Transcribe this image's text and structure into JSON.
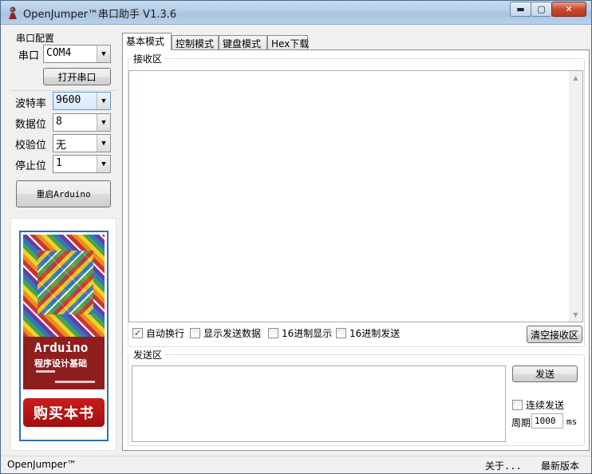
{
  "window": {
    "title": "OpenJumper™串口助手  V1.3.6",
    "controls": {
      "minimize": "▬",
      "maximize": "▢",
      "close": "✕"
    }
  },
  "left": {
    "group_title": "串口配置",
    "port_label": "串口",
    "port_value": "COM4",
    "open_button": "打开串口",
    "baud_label": "波特率",
    "baud_value": "9600",
    "databits_label": "数据位",
    "databits_value": "8",
    "parity_label": "校验位",
    "parity_value": "无",
    "stopbits_label": "停止位",
    "stopbits_value": "1",
    "restart_button": "重启Arduino",
    "book": {
      "title": "Arduino",
      "subtitle": "程序设计基础",
      "buy_button": "购买本书"
    }
  },
  "tabs": [
    {
      "label": "基本模式",
      "active": true
    },
    {
      "label": "控制模式",
      "active": false
    },
    {
      "label": "键盘模式",
      "active": false
    },
    {
      "label": "Hex下载",
      "active": false
    }
  ],
  "receive": {
    "legend": "接收区",
    "options": {
      "auto_wrap": {
        "label": "自动换行",
        "checked": true
      },
      "show_sent": {
        "label": "显示发送数据",
        "checked": false
      },
      "hex_display": {
        "label": "16进制显示",
        "checked": false
      },
      "hex_send": {
        "label": "16进制发送",
        "checked": false
      }
    },
    "clear_button": "清空接收区"
  },
  "send": {
    "legend": "发送区",
    "send_button": "发送",
    "continuous": {
      "label": "连续发送",
      "checked": false
    },
    "period_label": "周期",
    "period_value": "1000",
    "period_unit": "ms"
  },
  "status": {
    "left": "OpenJumper™",
    "about": "关于...",
    "latest": "最新版本"
  },
  "colors": {
    "accent": "#2e6fb3",
    "buy_button": "#b51515"
  }
}
